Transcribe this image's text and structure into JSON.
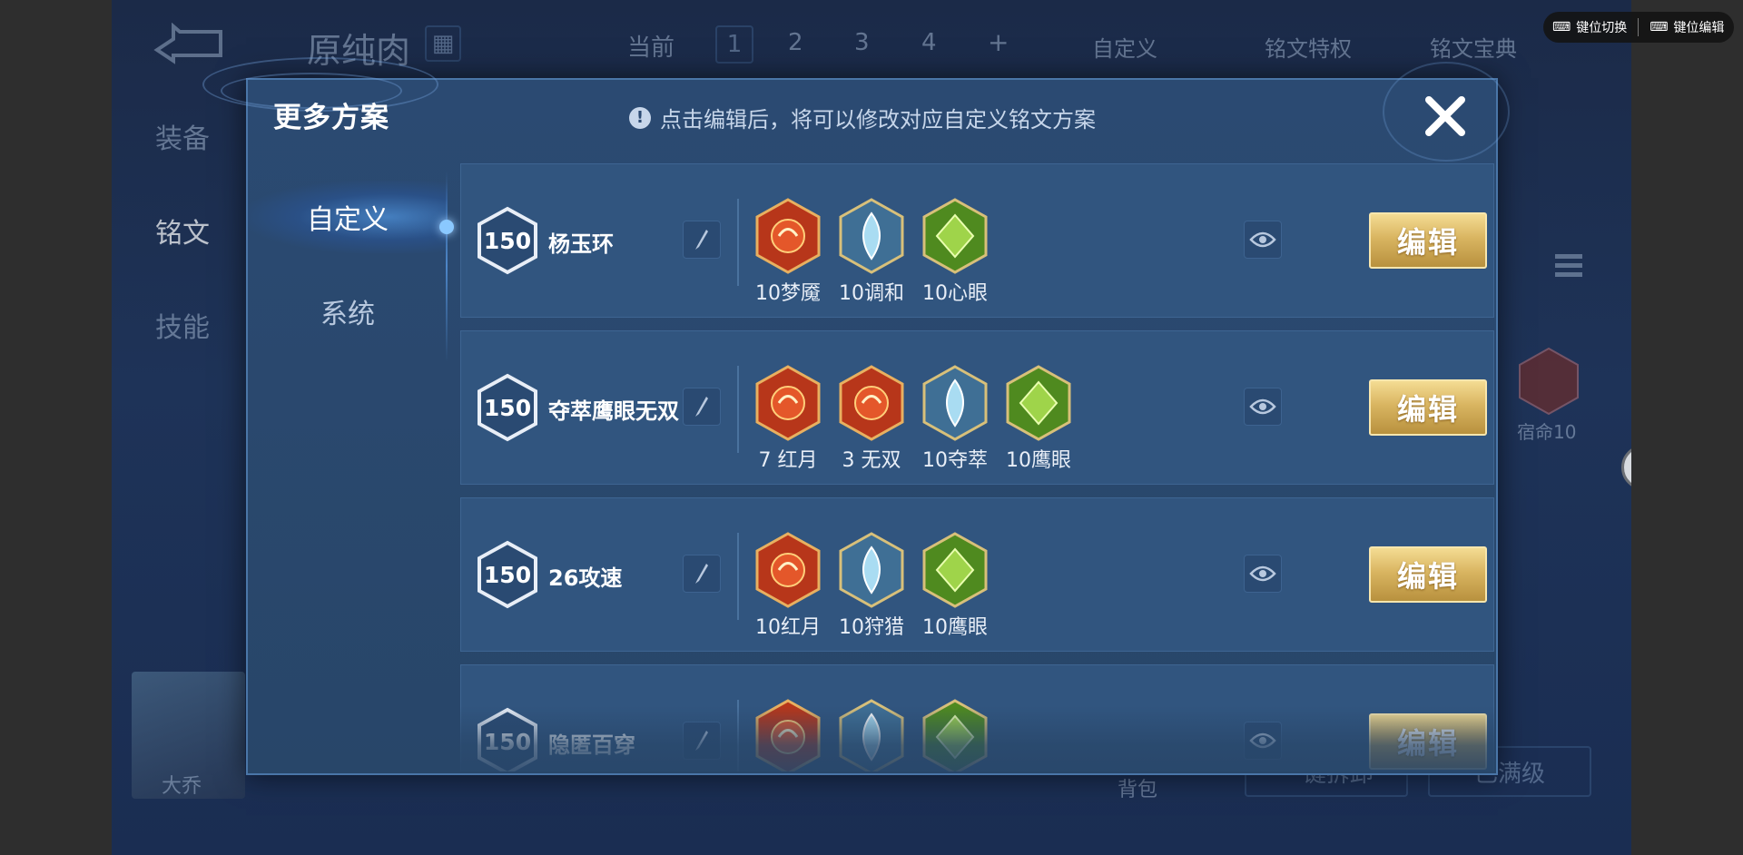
{
  "background": {
    "hero_name": "原纯肉",
    "current_label": "当前",
    "pages": [
      "1",
      "2",
      "3",
      "4",
      "+"
    ],
    "custom_label": "自定义",
    "privilege_label": "铭文特权",
    "treasure_label": "铭文宝典",
    "side_tabs": [
      "装备",
      "铭文",
      "技能"
    ],
    "right_rune_label": "宿命10",
    "hero_caption": "大乔",
    "bag_label": "背包",
    "bottom_btn_1": "一键拆卸",
    "bottom_btn_2": "已满级"
  },
  "overlay": {
    "item1": "键位切换",
    "item2": "键位编辑"
  },
  "dialog": {
    "title": "更多方案",
    "tip": "点击编辑后，将可以修改对应自定义铭文方案",
    "tabs": [
      "自定义",
      "系统"
    ],
    "edit_label": "编辑",
    "plans": [
      {
        "level": "150",
        "name": "杨玉环",
        "runes": [
          {
            "label": "10梦魇",
            "color": "red"
          },
          {
            "label": "10调和",
            "color": "blue"
          },
          {
            "label": "10心眼",
            "color": "green"
          }
        ]
      },
      {
        "level": "150",
        "name": "夺萃鹰眼无双",
        "runes": [
          {
            "label": "7 红月",
            "color": "red"
          },
          {
            "label": "3 无双",
            "color": "red"
          },
          {
            "label": "10夺萃",
            "color": "blue"
          },
          {
            "label": "10鹰眼",
            "color": "green"
          }
        ]
      },
      {
        "level": "150",
        "name": "26攻速",
        "runes": [
          {
            "label": "10红月",
            "color": "red"
          },
          {
            "label": "10狩猎",
            "color": "blue"
          },
          {
            "label": "10鹰眼",
            "color": "green"
          }
        ]
      },
      {
        "level": "150",
        "name": "隐匿百穿",
        "runes": [
          {
            "label": "",
            "color": "red"
          },
          {
            "label": "",
            "color": "blue"
          },
          {
            "label": "",
            "color": "green"
          }
        ]
      }
    ]
  },
  "colors": {
    "red": "#c8401e",
    "blue": "#6fb4d8",
    "green": "#6fae2e",
    "gold": "#d9b561"
  }
}
